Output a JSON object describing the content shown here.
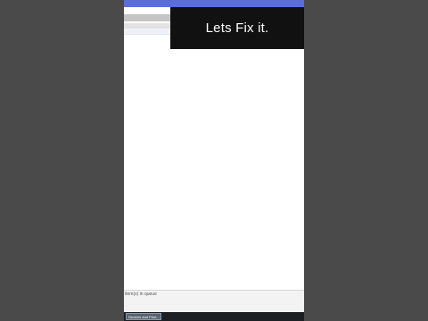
{
  "caption": {
    "text": "Lets Fix it."
  },
  "status_bar": {
    "text": "item(s) in queue"
  },
  "taskbar": {
    "item_label": "Devices and Print..."
  },
  "colors": {
    "title_bar": "#5b6ed6",
    "caption_bg": "#111111",
    "caption_text": "#ffffff",
    "pillarbox": "#4a4a4a",
    "taskbar": "#1c1f24"
  }
}
